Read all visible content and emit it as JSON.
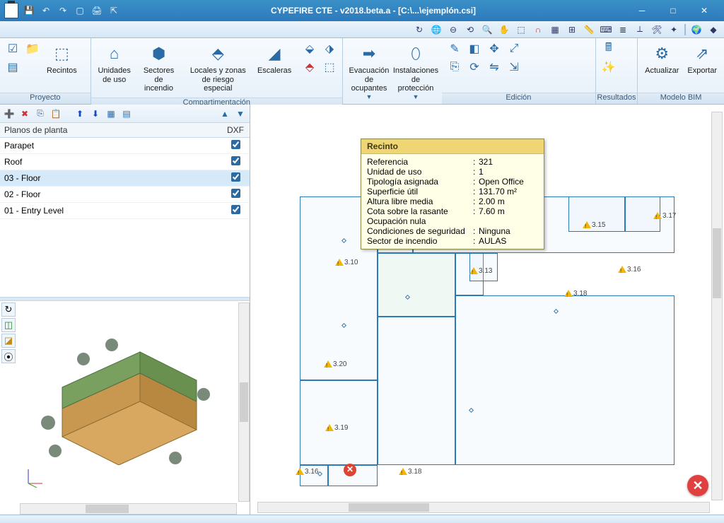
{
  "window": {
    "title": "CYPEFIRE CTE - v2018.beta.a - [C:\\...\\ejemplón.csi]"
  },
  "ribbon": {
    "groups": {
      "proyecto": "Proyecto",
      "compart": "Compartimentación",
      "edicion": "Edición",
      "resultados": "Resultados",
      "modelobim": "Modelo BIM"
    },
    "buttons": {
      "recintos": "Recintos",
      "unidades": "Unidades\nde uso",
      "sectores": "Sectores\nde incendio",
      "locales": "Locales y zonas\nde riesgo especial",
      "escaleras": "Escaleras",
      "evacuacion": "Evacuación\nde ocupantes",
      "instalaciones": "Instalaciones\nde protección",
      "actualizar": "Actualizar",
      "exportar": "Exportar"
    }
  },
  "floors": {
    "header_name": "Planos de planta",
    "header_dxf": "DXF",
    "rows": [
      {
        "name": "Parapet",
        "dxf": true,
        "sel": false
      },
      {
        "name": "Roof",
        "dxf": true,
        "sel": false
      },
      {
        "name": "03 - Floor",
        "dxf": true,
        "sel": true
      },
      {
        "name": "02 - Floor",
        "dxf": true,
        "sel": false
      },
      {
        "name": "01 - Entry Level",
        "dxf": true,
        "sel": false
      }
    ]
  },
  "tooltip": {
    "title": "Recinto",
    "rows": [
      {
        "k": "Referencia",
        "v": "321"
      },
      {
        "k": "Unidad de uso",
        "v": "1"
      },
      {
        "k": "Tipología asignada",
        "v": "Open Office"
      },
      {
        "k": "Superficie útil",
        "v": "131.70 m²"
      },
      {
        "k": "Altura libre media",
        "v": "2.00 m"
      },
      {
        "k": "Cota sobre la rasante",
        "v": "7.60 m"
      },
      {
        "k": "Ocupación nula",
        "v": ""
      },
      {
        "k": "Condiciones de seguridad",
        "v": "Ninguna"
      },
      {
        "k": "Sector de incendio",
        "v": "AULAS"
      }
    ]
  },
  "markers": [
    "3.10",
    "3.13",
    "3.15",
    "3.16",
    "3.17",
    "3.18",
    "3.20",
    "3.19",
    "3.16",
    "3.18"
  ],
  "colors": {
    "accent": "#2a7ab8",
    "titlebar": "#2d7abc",
    "tooltip": "#f0d574"
  }
}
